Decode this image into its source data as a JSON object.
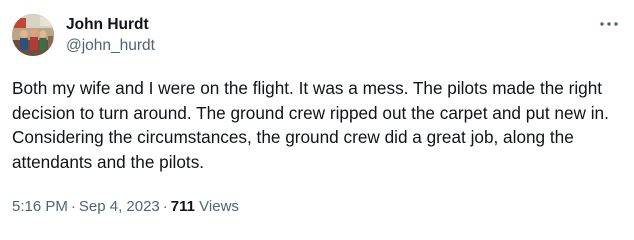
{
  "author": {
    "display_name": "John Hurdt",
    "handle": "@john_hurdt"
  },
  "more_icon": "more-horizontal-icon",
  "tweet": {
    "text": "Both my wife and I were on the flight. It was a mess. The pilots made the right decision to turn around. The ground crew ripped out the carpet and put new in. Considering the circumstances, the ground crew did a great job, along the attendants and the pilots."
  },
  "meta": {
    "time": "5:16 PM",
    "separator": "·",
    "date": "Sep 4, 2023",
    "views_count": "711",
    "views_label": "Views"
  },
  "colors": {
    "text_primary": "#0f1419",
    "text_secondary": "#536471",
    "background": "#ffffff"
  }
}
